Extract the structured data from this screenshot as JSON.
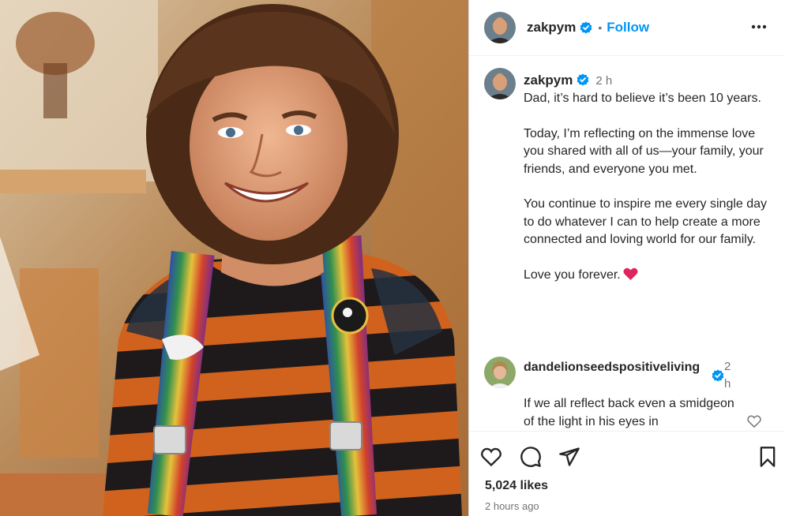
{
  "post": {
    "author": "zakpym",
    "follow_label": "Follow",
    "dot": "•",
    "photo_alt": "Photo of a smiling man wearing a striped orange and black shirt with rainbow suspenders"
  },
  "caption": {
    "username": "zakpym",
    "time": "2 h",
    "paragraphs": [
      "Dad, it’s hard to believe it’s been 10 years.",
      "Today, I’m reflecting on the immense love you shared with all of us—your family, your friends, and everyone you met.",
      "You continue to inspire me every single day to do whatever I can to help create a more connected and loving world for our family.",
      "Love you forever."
    ]
  },
  "comment": {
    "username": "dandelionseedspositiveliving",
    "time": "2h",
    "text": "If we all reflect back even a smidgeon of the light in his eyes in"
  },
  "stats": {
    "likes": "5,024 likes",
    "posted": "2 hours ago"
  },
  "icons": {
    "verified": "verified-badge-icon",
    "more": "more-options-icon",
    "like": "heart-outline-icon",
    "comment": "comment-icon",
    "share": "share-icon",
    "save": "bookmark-icon",
    "emoji": "red-heart-emoji"
  },
  "colors": {
    "accent": "#0095f6",
    "text": "#262626",
    "muted": "#737373",
    "heart": "#e0245e"
  }
}
